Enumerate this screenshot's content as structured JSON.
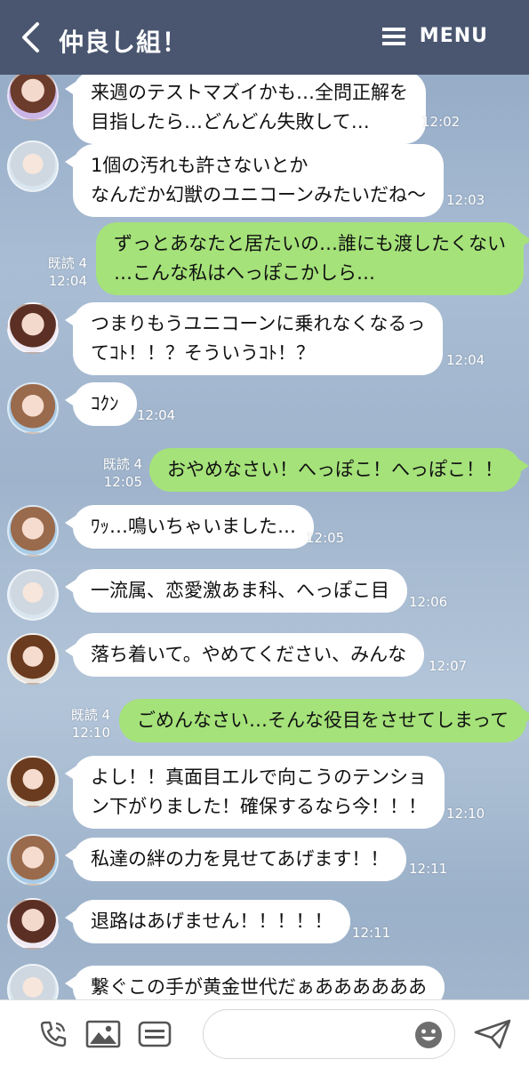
{
  "header": {
    "title": "仲良し組！",
    "menu_label": "MENU"
  },
  "colors": {
    "header_bg": "#4a5670",
    "outgoing_bubble": "#a5e27a",
    "incoming_bubble": "#ffffff"
  },
  "messages": [
    {
      "dir": "in",
      "avatar": "avatar-a",
      "lines": [
        "来週のテストマズイかも…全問正解を",
        "目指したら…どんどん失敗して…"
      ],
      "time": "12:02"
    },
    {
      "dir": "in",
      "avatar": "avatar-b",
      "lines": [
        "1個の汚れも許さないとか",
        "なんだか幻獣のユニコーンみたいだね〜"
      ],
      "time": "12:03"
    },
    {
      "dir": "out",
      "lines": [
        "ずっとあなたと居たいの…誰にも渡したくない",
        "…こんな私はへっぽこかしら…"
      ],
      "read": "既読 4",
      "time": "12:04"
    },
    {
      "dir": "in",
      "avatar": "avatar-a",
      "lines": [
        "つまりもうユニコーンに乗れなくなるっ",
        "てｺﾄ！！？そういうｺﾄ！？"
      ],
      "time": "12:04"
    },
    {
      "dir": "in",
      "avatar": "avatar-c",
      "lines": [
        "ｺｸﾝ"
      ],
      "time": "12:04"
    },
    {
      "dir": "out",
      "lines": [
        "おやめなさい！へっぽこ！へっぽこ！！"
      ],
      "read": "既読 4",
      "time": "12:05"
    },
    {
      "dir": "in",
      "avatar": "avatar-c",
      "lines": [
        "ﾜｯ…鳴いちゃいました…"
      ],
      "time": "12:05"
    },
    {
      "dir": "in",
      "avatar": "avatar-b",
      "lines": [
        "一流属、恋愛激あま科、へっぽこ目"
      ],
      "time": "12:06"
    },
    {
      "dir": "in",
      "avatar": "avatar-d",
      "lines": [
        "落ち着いて。やめてください、みんな"
      ],
      "time": "12:07"
    },
    {
      "dir": "out",
      "lines": [
        "ごめんなさい…そんな役目をさせてしまって"
      ],
      "read": "既読 4",
      "time": "12:10"
    },
    {
      "dir": "in",
      "avatar": "avatar-d",
      "lines": [
        "よし！！真面目エルで向こうのテンショ",
        "ン下がりました！確保するなら今！！！"
      ],
      "time": "12:10"
    },
    {
      "dir": "in",
      "avatar": "avatar-c",
      "lines": [
        "私達の絆の力を見せてあげます！！"
      ],
      "time": "12:11"
    },
    {
      "dir": "in",
      "avatar": "avatar-a",
      "lines": [
        "退路はあげません！！！！！"
      ],
      "time": "12:11"
    },
    {
      "dir": "in",
      "avatar": "avatar-b",
      "lines": [
        "繋ぐこの手が黄金世代だぁああああああ"
      ],
      "time": ""
    }
  ],
  "composer": {
    "placeholder": ""
  },
  "icons": [
    "back-icon",
    "menu-icon",
    "call-icon",
    "image-icon",
    "keyboard-icon",
    "emoji-icon",
    "send-icon"
  ]
}
